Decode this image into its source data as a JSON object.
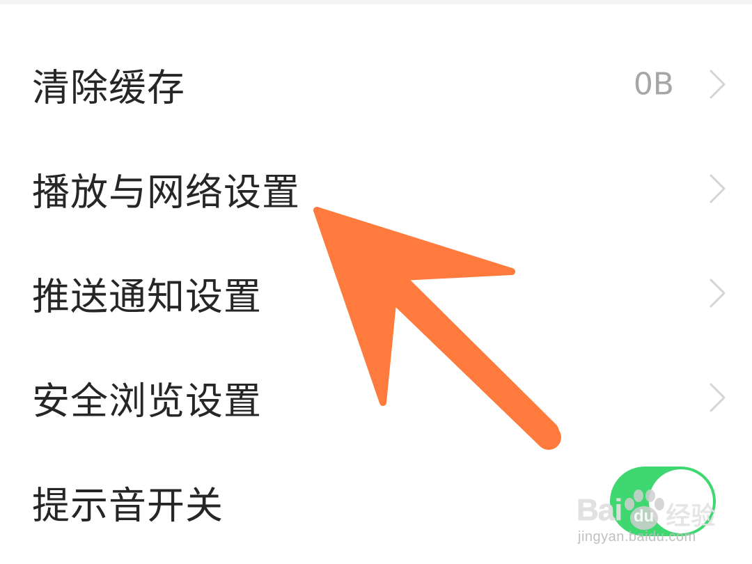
{
  "settings": {
    "items": [
      {
        "label": "清除缓存",
        "value": "0B",
        "has_chevron": true
      },
      {
        "label": "播放与网络设置",
        "has_chevron": true
      },
      {
        "label": "推送通知设置",
        "has_chevron": true
      },
      {
        "label": "安全浏览设置",
        "has_chevron": true
      },
      {
        "label": "提示音开关",
        "toggle": "on"
      }
    ]
  },
  "annotation": {
    "arrow_color": "#ff7a3d",
    "points_to": "播放与网络设置"
  },
  "watermark": {
    "logo": "Bai du 经验",
    "url": "jingyan.baidu.com"
  },
  "colors": {
    "toggle_on": "#3ed770",
    "label_text": "#262626",
    "value_text": "#a6a6a6",
    "chevron": "#d4d4d4"
  }
}
